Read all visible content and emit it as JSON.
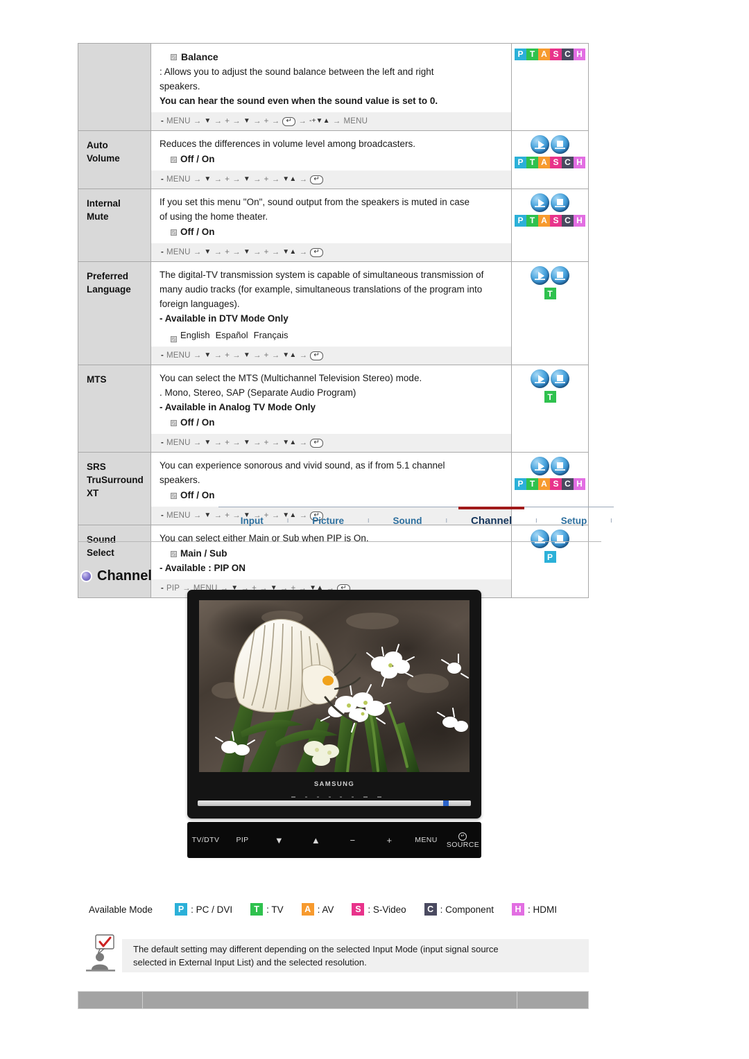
{
  "spec_table": {
    "rows": [
      {
        "label_lines": [],
        "title": "Balance",
        "body": [
          ": Allows you to adjust the sound balance between the left and right",
          "speakers."
        ],
        "bold_note": "You can hear the sound even when the sound value is set to 0.",
        "keyseq": "MENU → ▼ → + → ▼ → + → ⏎ → -+▼▲ → MENU",
        "keyseq_parts": [
          "MENU",
          "▼",
          "+",
          "▼",
          "+",
          "KBD",
          "-+▼▲",
          "MENU"
        ],
        "icons": {
          "circles": false,
          "strip": [
            "P",
            "T",
            "A",
            "S",
            "C",
            "H"
          ]
        }
      },
      {
        "label_lines": [
          "Auto",
          "Volume"
        ],
        "body": [
          "Reduces the differences in volume level among broadcasters."
        ],
        "option": "Off / On",
        "keyseq_parts": [
          "MENU",
          "▼",
          "+",
          "▼",
          "+",
          "▼▲",
          "KBD"
        ],
        "icons": {
          "circles": true,
          "strip": [
            "P",
            "T",
            "A",
            "S",
            "C",
            "H"
          ]
        }
      },
      {
        "label_lines": [
          "Internal",
          "Mute"
        ],
        "body": [
          "If you set this menu \"On\", sound output from the speakers is muted in case",
          "of using the home theater."
        ],
        "option": "Off / On",
        "keyseq_parts": [
          "MENU",
          "▼",
          "+",
          "▼",
          "+",
          "▼▲",
          "KBD"
        ],
        "icons": {
          "circles": true,
          "strip": [
            "P",
            "T",
            "A",
            "S",
            "C",
            "H"
          ]
        }
      },
      {
        "label_lines": [
          "Preferred",
          "Language"
        ],
        "body": [
          "The digital-TV transmission system is capable of simultaneous transmission of",
          "many audio tracks (for example, simultaneous translations of the program into",
          "foreign languages)."
        ],
        "dash_bold": "- Available in DTV Mode Only",
        "languages": [
          "English",
          "Español",
          "Français"
        ],
        "keyseq_parts": [
          "MENU",
          "▼",
          "+",
          "▼",
          "+",
          "▼▲",
          "KBD"
        ],
        "icons": {
          "circles": true,
          "strip": [
            "T"
          ]
        }
      },
      {
        "label_lines": [
          "MTS"
        ],
        "body": [
          "You can select the MTS (Multichannel Television Stereo) mode.",
          ". Mono, Stereo, SAP (Separate Audio Program)"
        ],
        "dash_bold": "- Available in Analog TV Mode Only",
        "option": "Off / On",
        "keyseq_parts": [
          "MENU",
          "▼",
          "+",
          "▼",
          "+",
          "▼▲",
          "KBD"
        ],
        "icons": {
          "circles": true,
          "strip": [
            "T"
          ]
        }
      },
      {
        "label_lines": [
          "SRS",
          "TruSurround",
          "XT"
        ],
        "body": [
          "You can experience sonorous and vivid sound, as if from 5.1 channel",
          "speakers."
        ],
        "option": "Off / On",
        "keyseq_parts": [
          "MENU",
          "▼",
          "+",
          "▼",
          "+",
          "▼▲",
          "KBD"
        ],
        "icons": {
          "circles": true,
          "strip": [
            "P",
            "T",
            "A",
            "S",
            "C",
            "H"
          ]
        }
      },
      {
        "label_lines": [
          "Sound",
          "Select"
        ],
        "body": [
          "You can select either Main or Sub when PIP is On."
        ],
        "option": "Main / Sub",
        "dash_bold": "- Available : PIP ON",
        "keyseq_parts": [
          "PIP",
          "MENU",
          "▼",
          "+",
          "▼",
          "+",
          "▼▲",
          "KBD"
        ],
        "icons": {
          "circles": true,
          "strip": [
            "P"
          ]
        }
      }
    ]
  },
  "tabs": {
    "items": [
      {
        "label": "Input",
        "active": false
      },
      {
        "label": "Picture",
        "active": false
      },
      {
        "label": "Sound",
        "active": false
      },
      {
        "label": "Channel",
        "active": true
      },
      {
        "label": "Setup",
        "active": false
      }
    ],
    "separator": "ı",
    "active_underline_color": "#a01a1a",
    "link_color": "#2d6f9e",
    "active_color": "#16365c"
  },
  "section": {
    "heading": "Channel",
    "bullet_color": "#6b5fb8"
  },
  "monitor": {
    "brand": "SAMSUNG",
    "controls": [
      "TV/DTV",
      "PIP",
      "▼",
      "▲",
      "−",
      "+",
      "MENU"
    ],
    "source_label": "SOURCE"
  },
  "legend": {
    "title": "Available Mode",
    "items": [
      {
        "code": "P",
        "label": ": PC / DVI",
        "color": "#2bb0d8"
      },
      {
        "code": "T",
        "label": ": TV",
        "color": "#2fc14e"
      },
      {
        "code": "A",
        "label": ": AV",
        "color": "#f79a2e"
      },
      {
        "code": "S",
        "label": ": S-Video",
        "color": "#e8338b"
      },
      {
        "code": "C",
        "label": ": Component",
        "color": "#4a4a60"
      },
      {
        "code": "H",
        "label": ": HDMI",
        "color": "#e26ee2"
      }
    ]
  },
  "note": {
    "lines": [
      "The default setting may different depending on the selected Input Mode (input signal source",
      "selected in External Input List) and the selected resolution."
    ]
  }
}
